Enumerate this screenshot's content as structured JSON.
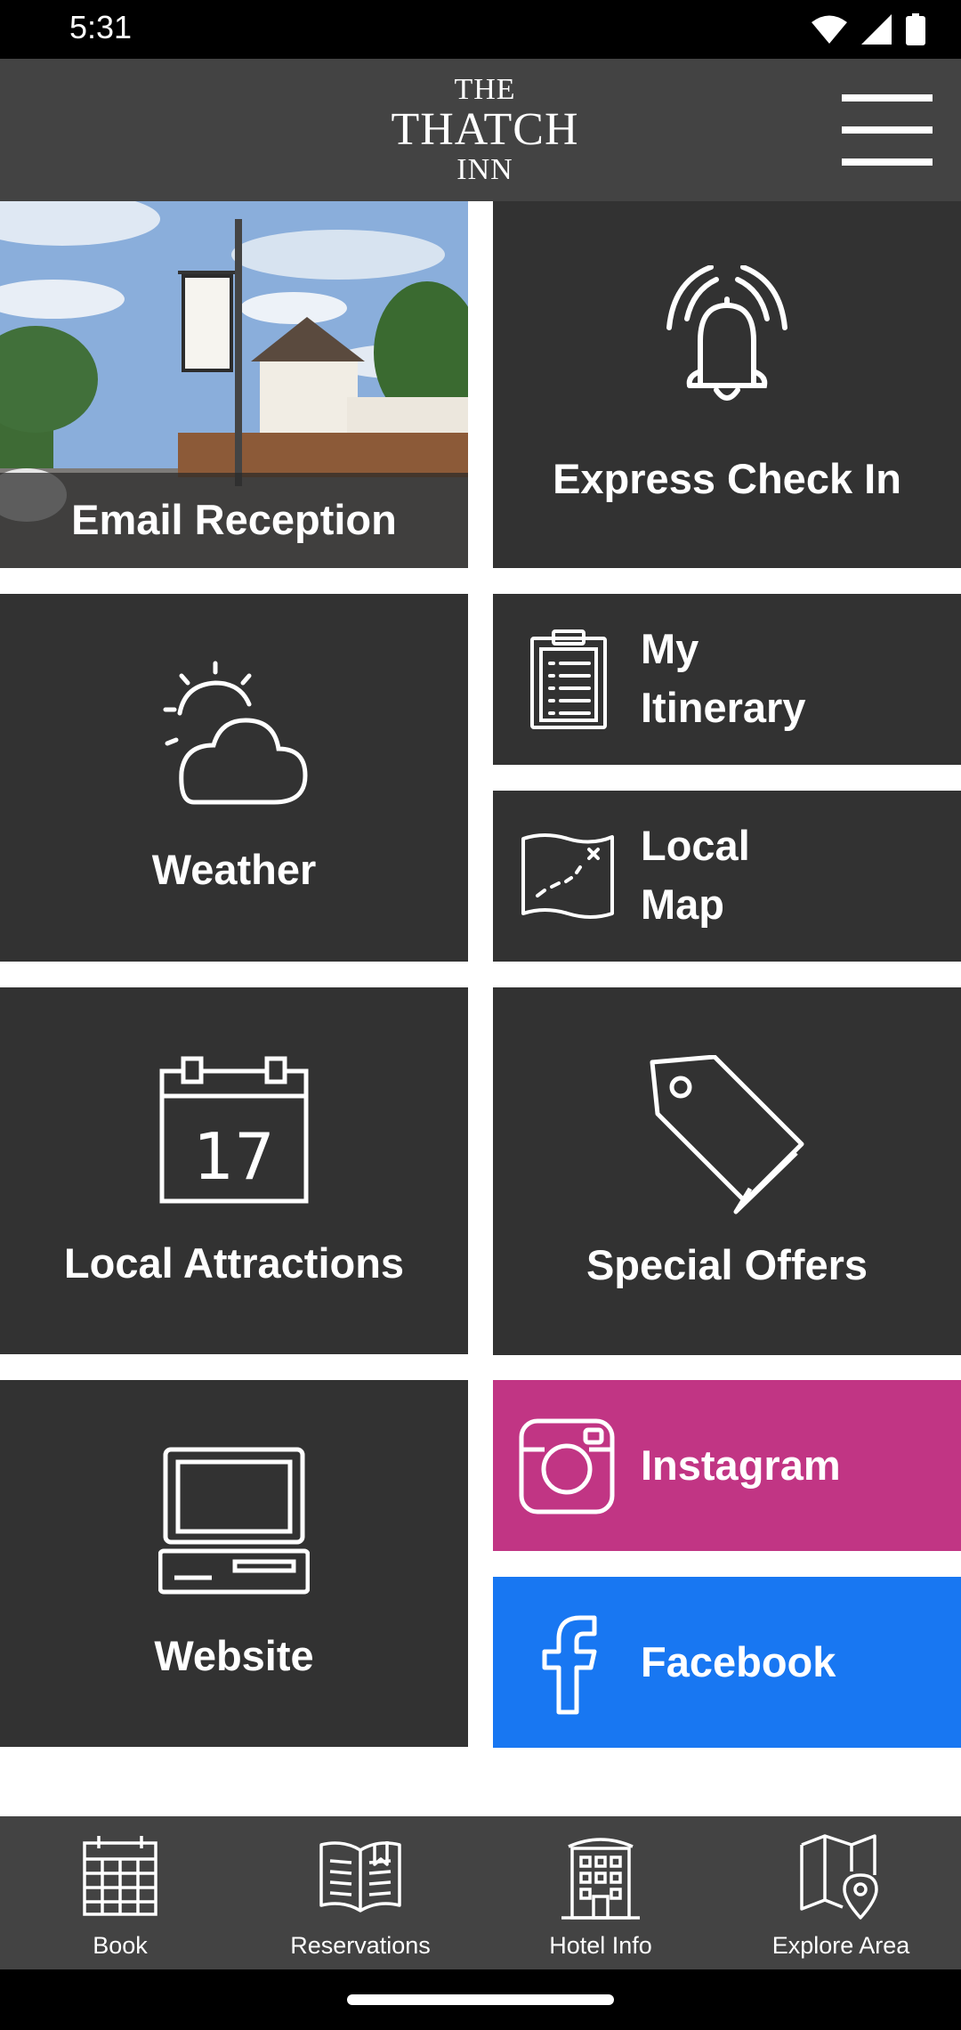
{
  "status_bar": {
    "time": "5:31"
  },
  "header": {
    "logo": {
      "line1": "THE",
      "line2": "THATCH",
      "line3": "INN"
    }
  },
  "tiles": {
    "email_reception": {
      "label": "Email Reception"
    },
    "express_check_in": {
      "label": "Express Check In"
    },
    "weather": {
      "label": "Weather"
    },
    "my_itinerary": {
      "line1": "My",
      "line2": "Itinerary"
    },
    "local_map": {
      "line1": "Local",
      "line2": "Map"
    },
    "local_attractions": {
      "label": "Local Attractions",
      "calendar_day": "17"
    },
    "special_offers": {
      "label": "Special Offers"
    },
    "website": {
      "label": "Website"
    },
    "instagram": {
      "label": "Instagram",
      "color": "#c13584"
    },
    "facebook": {
      "label": "Facebook",
      "color": "#1877f2"
    }
  },
  "tab_bar": {
    "items": [
      {
        "label": "Book",
        "icon": "calendar-grid-icon"
      },
      {
        "label": "Reservations",
        "icon": "open-book-icon"
      },
      {
        "label": "Hotel Info",
        "icon": "hotel-building-icon"
      },
      {
        "label": "Explore Area",
        "icon": "map-pin-icon"
      }
    ]
  },
  "colors": {
    "tile_bg": "#323232",
    "header_bg": "#434343"
  }
}
